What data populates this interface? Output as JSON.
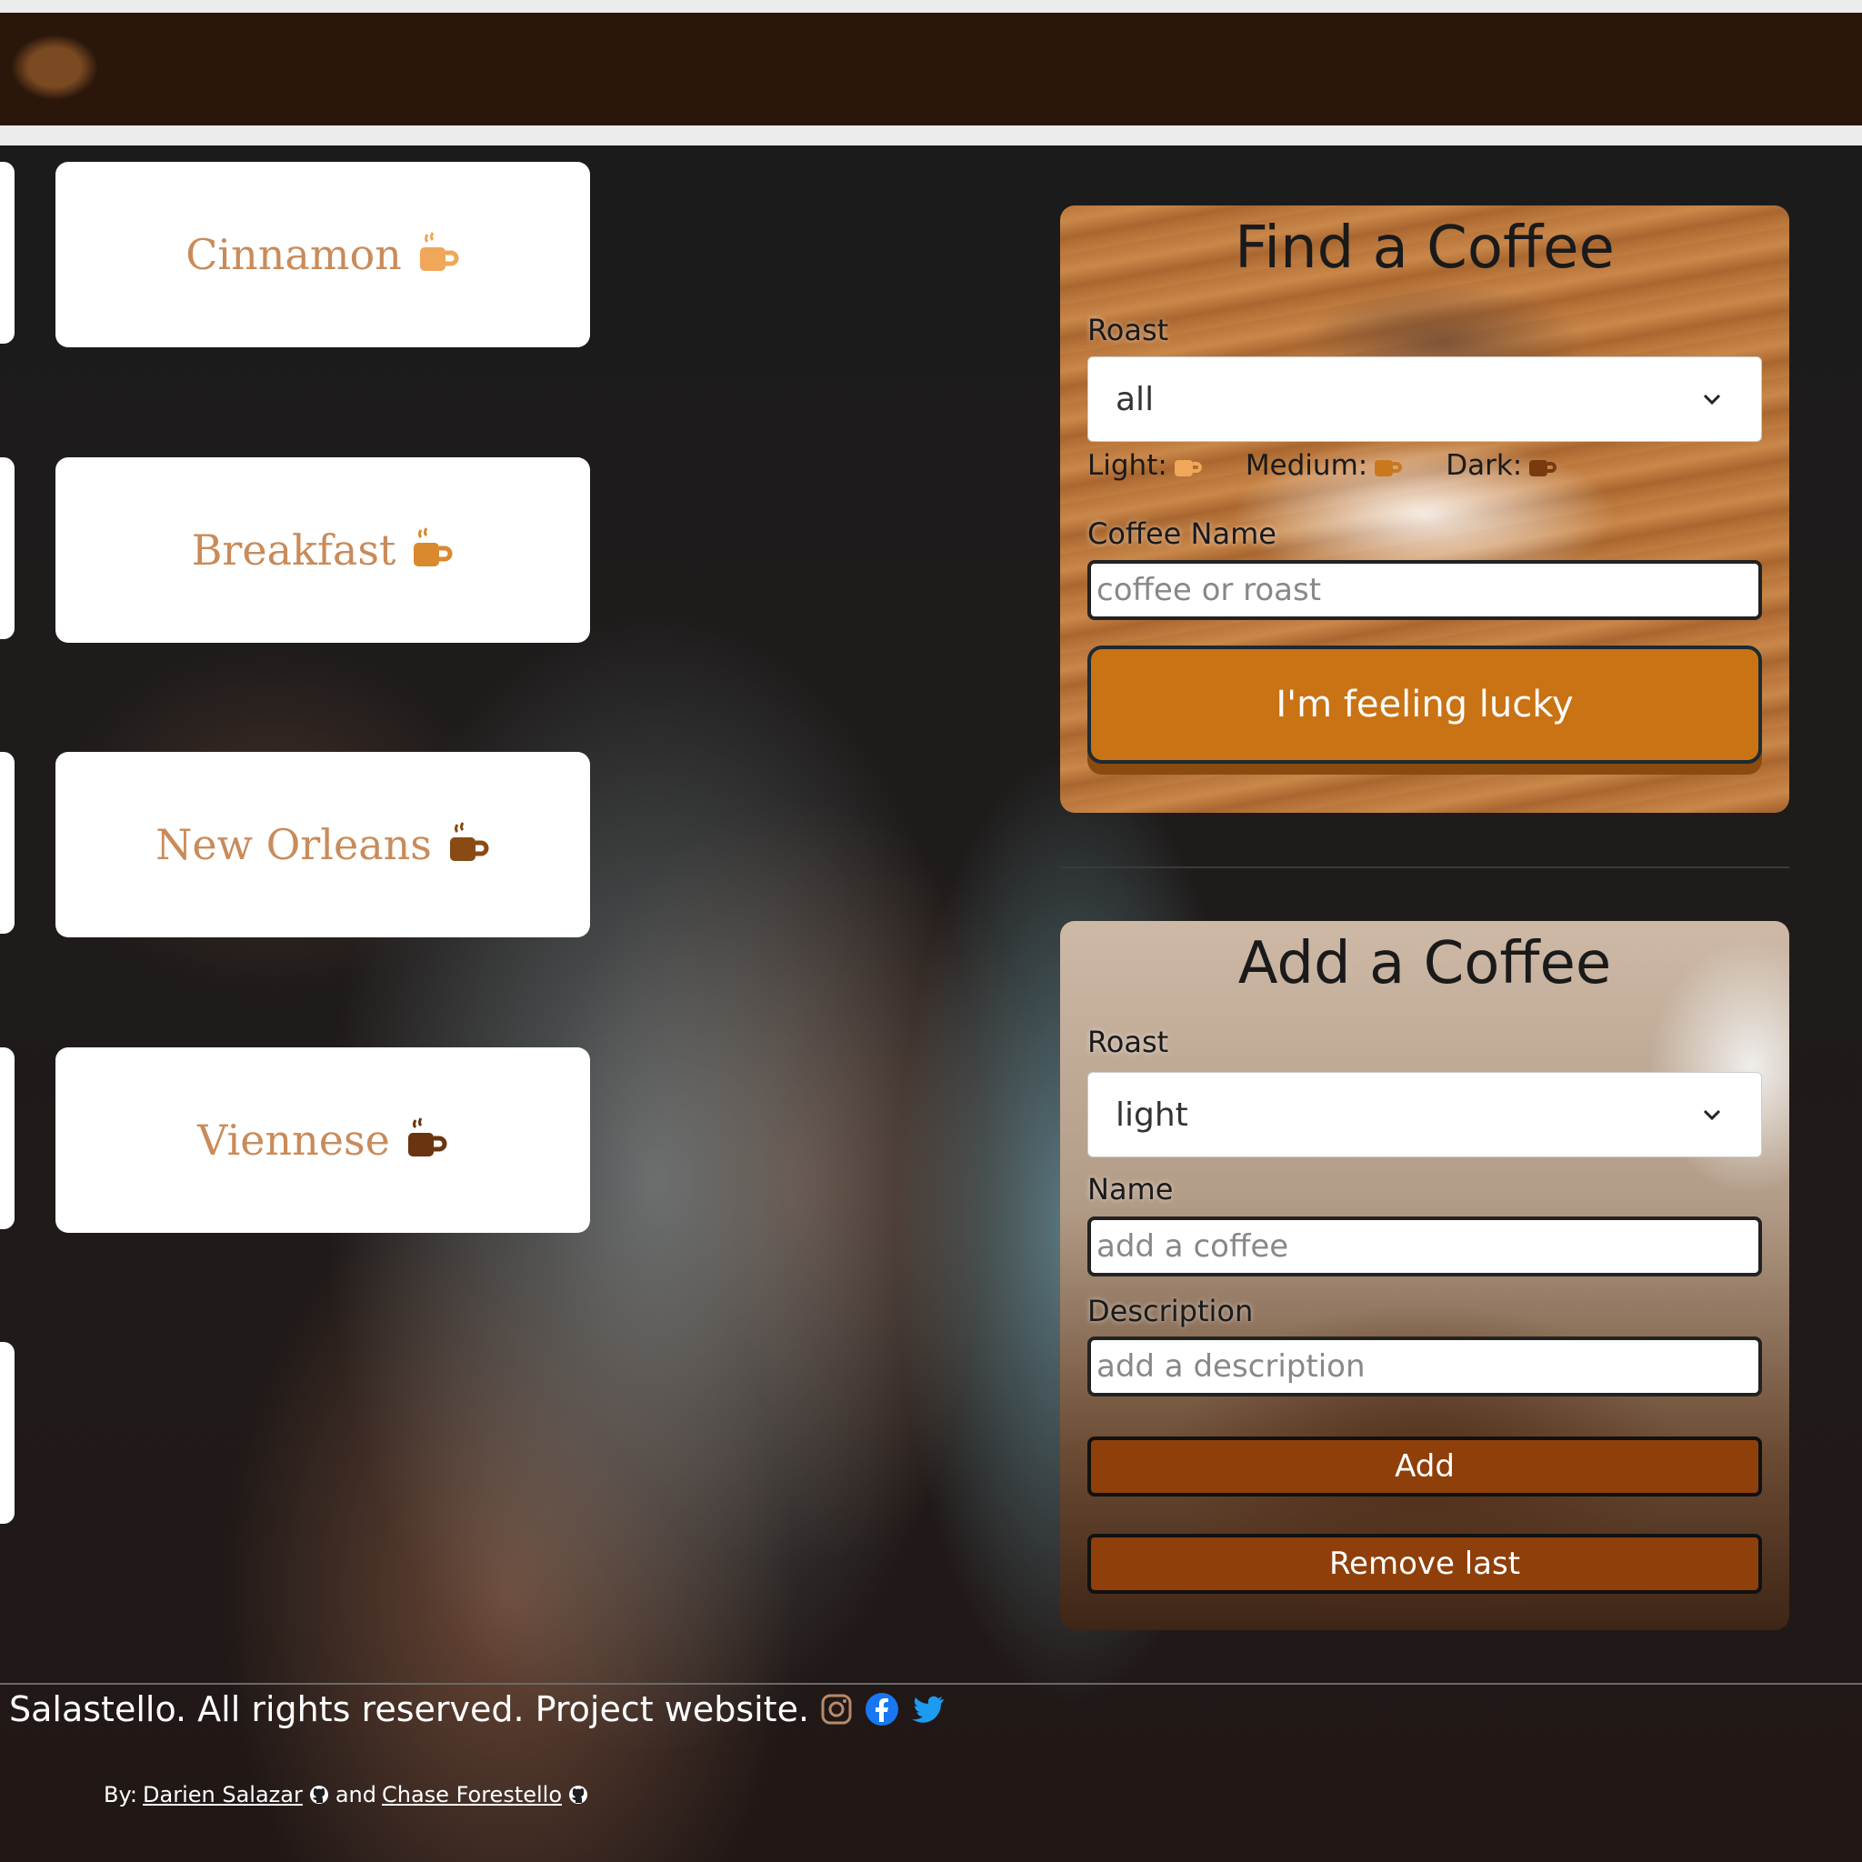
{
  "coffees": [
    {
      "name": "Cinnamon",
      "cup_color": "#f0a75a"
    },
    {
      "name": "Breakfast",
      "cup_color": "#d98a2e"
    },
    {
      "name": "New Orleans",
      "cup_color": "#8a4a14"
    },
    {
      "name": "Viennese",
      "cup_color": "#6b3410"
    }
  ],
  "find": {
    "title": "Find a Coffee",
    "roast_label": "Roast",
    "roast_value": "all",
    "legend": [
      {
        "label": "Light:",
        "cup_color": "#f0a75a"
      },
      {
        "label": "Medium:",
        "cup_color": "#c9781d"
      },
      {
        "label": "Dark:",
        "cup_color": "#7a3a10"
      }
    ],
    "name_label": "Coffee Name",
    "name_placeholder": "coffee or roast",
    "lucky_label": "I'm feeling lucky"
  },
  "add": {
    "title": "Add a Coffee",
    "roast_label": "Roast",
    "roast_value": "light",
    "name_label": "Name",
    "name_placeholder": "add a coffee",
    "desc_label": "Description",
    "desc_placeholder": "add a description",
    "add_label": "Add",
    "remove_label": "Remove last"
  },
  "footer": {
    "text": "Salastello. All rights reserved. Project website.",
    "by": "By:",
    "author1": "Darien Salazar",
    "and": "and",
    "author2": "Chase Forestello",
    "instagram_color": "#b88a6a",
    "facebook_color": "#1877f2",
    "twitter_color": "#1d9bf0"
  },
  "accent_colors": {
    "lucky_button": "#c97315",
    "brown_button": "#8f3f0a",
    "card_text": "#c98b5a"
  }
}
